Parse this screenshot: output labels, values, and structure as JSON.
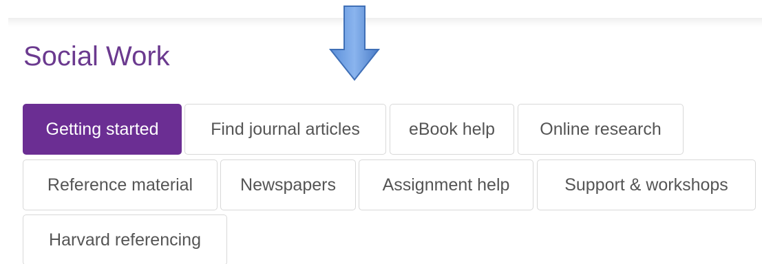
{
  "page": {
    "title": "Social Work"
  },
  "annotation": {
    "arrow_icon": "down-arrow-icon",
    "arrow_color": "#4f86d8"
  },
  "tabs": [
    {
      "label": "Getting started",
      "active": true
    },
    {
      "label": "Find journal articles",
      "active": false
    },
    {
      "label": "eBook help",
      "active": false
    },
    {
      "label": "Online research",
      "active": false
    },
    {
      "label": "Reference material",
      "active": false
    },
    {
      "label": "Newspapers",
      "active": false
    },
    {
      "label": "Assignment help",
      "active": false
    },
    {
      "label": "Support & workshops",
      "active": false
    },
    {
      "label": "Harvard referencing",
      "active": false
    }
  ],
  "colors": {
    "accent": "#6b2e93",
    "title": "#6b3a8f",
    "tab_text": "#555555",
    "tab_border": "#d8d8d8"
  }
}
